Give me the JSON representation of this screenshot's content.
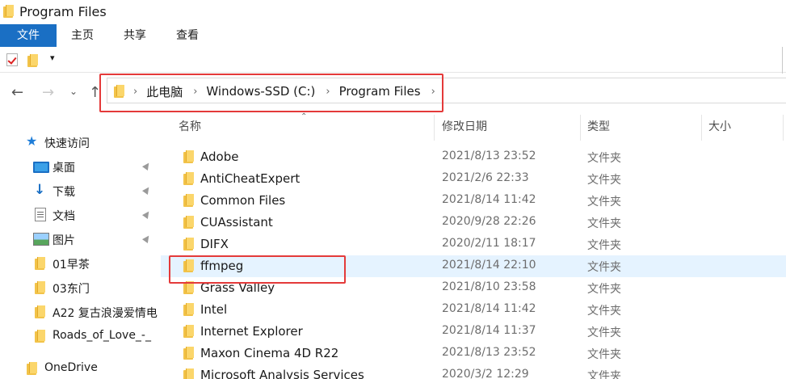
{
  "window": {
    "title": "Program Files"
  },
  "ribbon": {
    "tabs": [
      {
        "label": "文件",
        "active": true
      },
      {
        "label": "主页"
      },
      {
        "label": "共享"
      },
      {
        "label": "查看"
      }
    ]
  },
  "quick_access_toolbar": {
    "dropdown_glyph": "▾"
  },
  "nav": {
    "back_glyph": "←",
    "forward_glyph": "→",
    "recent_glyph": "⌄",
    "up_glyph": "↑",
    "breadcrumb": [
      "此电脑",
      "Windows-SSD (C:)",
      "Program Files"
    ]
  },
  "sidebar": {
    "items": [
      {
        "label": "快速访问",
        "icon": "star-icon"
      },
      {
        "label": "桌面",
        "icon": "desktop-icon",
        "pinned": true
      },
      {
        "label": "下载",
        "icon": "download-icon",
        "pinned": true
      },
      {
        "label": "文档",
        "icon": "document-icon",
        "pinned": true
      },
      {
        "label": "图片",
        "icon": "pictures-icon",
        "pinned": true
      },
      {
        "label": "01早茶",
        "icon": "folder-icon"
      },
      {
        "label": "03东门",
        "icon": "folder-icon"
      },
      {
        "label": "A22 复古浪漫爱情电",
        "icon": "folder-icon"
      },
      {
        "label": "Roads_of_Love_-_",
        "icon": "folder-icon"
      },
      {
        "label": "OneDrive",
        "icon": "folder-icon"
      }
    ]
  },
  "columns": {
    "name": "名称",
    "date": "修改日期",
    "type": "类型",
    "size": "大小"
  },
  "files": [
    {
      "name": "Adobe",
      "date": "2021/8/13 23:52",
      "type": "文件夹"
    },
    {
      "name": "AntiCheatExpert",
      "date": "2021/2/6 22:33",
      "type": "文件夹"
    },
    {
      "name": "Common Files",
      "date": "2021/8/14 11:42",
      "type": "文件夹"
    },
    {
      "name": "CUAssistant",
      "date": "2020/9/28 22:26",
      "type": "文件夹"
    },
    {
      "name": "DIFX",
      "date": "2020/2/11 18:17",
      "type": "文件夹"
    },
    {
      "name": "ffmpeg",
      "date": "2021/8/14 22:10",
      "type": "文件夹",
      "selected": true
    },
    {
      "name": "Grass Valley",
      "date": "2021/8/10 23:58",
      "type": "文件夹"
    },
    {
      "name": "Intel",
      "date": "2021/8/14 11:42",
      "type": "文件夹"
    },
    {
      "name": "Internet Explorer",
      "date": "2021/8/14 11:37",
      "type": "文件夹"
    },
    {
      "name": "Maxon Cinema 4D R22",
      "date": "2021/8/13 23:52",
      "type": "文件夹"
    },
    {
      "name": "Microsoft Analysis Services",
      "date": "2020/3/2 12:29",
      "type": "文件夹"
    }
  ],
  "colors": {
    "accent": "#1a6fc4",
    "annotation": "#e43a3a",
    "selection": "#e5f3ff",
    "folder": "#f2c349"
  }
}
